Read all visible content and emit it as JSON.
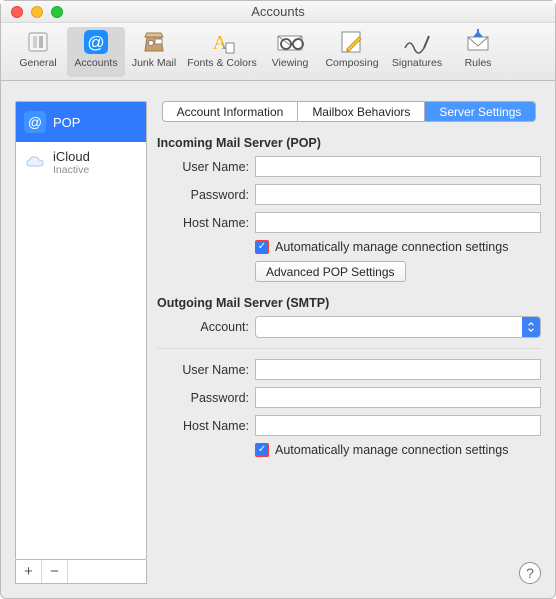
{
  "window": {
    "title": "Accounts"
  },
  "toolbar": {
    "items": [
      {
        "label": "General"
      },
      {
        "label": "Accounts"
      },
      {
        "label": "Junk Mail"
      },
      {
        "label": "Fonts & Colors"
      },
      {
        "label": "Viewing"
      },
      {
        "label": "Composing"
      },
      {
        "label": "Signatures"
      },
      {
        "label": "Rules"
      }
    ]
  },
  "sidebar": {
    "accounts": [
      {
        "name": "POP",
        "subtitle": ""
      },
      {
        "name": "iCloud",
        "subtitle": "Inactive"
      }
    ],
    "add": "+",
    "remove": "−"
  },
  "tabs": {
    "items": [
      {
        "label": "Account Information"
      },
      {
        "label": "Mailbox Behaviors"
      },
      {
        "label": "Server Settings"
      }
    ]
  },
  "incoming": {
    "heading": "Incoming Mail Server (POP)",
    "labels": {
      "user": "User Name:",
      "pass": "Password:",
      "host": "Host Name:"
    },
    "values": {
      "user": "",
      "pass": "",
      "host": ""
    },
    "auto": "Automatically manage connection settings",
    "advanced": "Advanced POP Settings"
  },
  "outgoing": {
    "heading": "Outgoing Mail Server (SMTP)",
    "labels": {
      "account": "Account:",
      "user": "User Name:",
      "pass": "Password:",
      "host": "Host Name:"
    },
    "values": {
      "account": "",
      "user": "",
      "pass": "",
      "host": ""
    },
    "auto": "Automatically manage connection settings"
  },
  "help": "?"
}
